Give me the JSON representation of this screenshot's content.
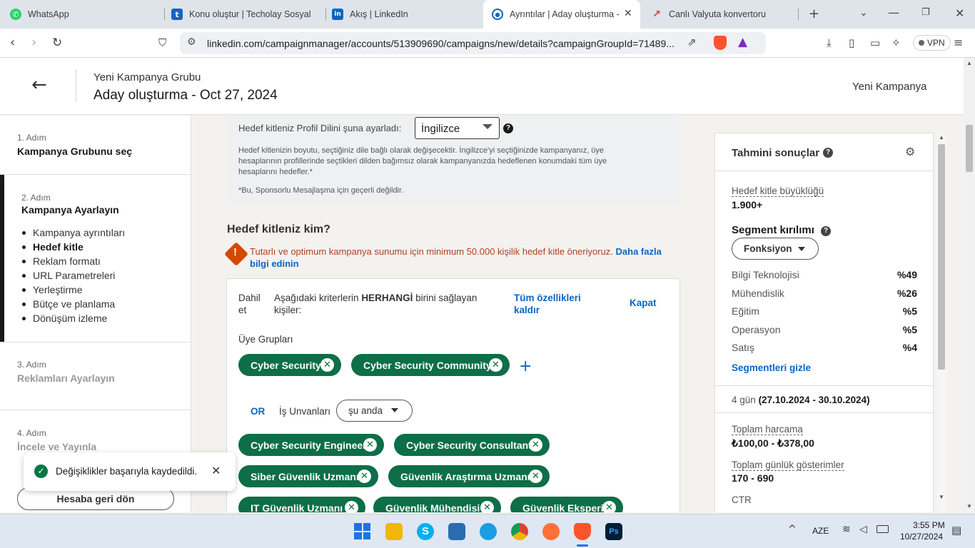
{
  "browser": {
    "tabs": [
      {
        "title": "WhatsApp",
        "fav_color": "#25d366",
        "fav_glyph": "✆"
      },
      {
        "title": "Konu oluştur | Techolay Sosyal",
        "fav_color": "#1565c0",
        "fav_glyph": "t"
      },
      {
        "title": "Akış | LinkedIn",
        "fav_color": "#0a66c2",
        "fav_glyph": "in"
      },
      {
        "title": "Ayrıntılar | Aday oluşturma -",
        "fav_color": "#0a66c2",
        "fav_glyph": "◎"
      },
      {
        "title": "Canlı Valyuta konvertoru",
        "fav_color": "#e53935",
        "fav_glyph": "↗"
      }
    ],
    "url": "linkedin.com/campaignmanager/accounts/513909690/campaigns/new/details?campaignGroupId=71489...",
    "vpn_label": "VPN"
  },
  "header": {
    "group_label": "Yeni Kampanya Grubu",
    "title": "Aday oluşturma - Oct 27, 2024",
    "right_label": "Yeni Kampanya"
  },
  "sidebar": {
    "step1_label": "1. Adım",
    "step1_title": "Kampanya Grubunu seç",
    "step2_label": "2. Adım",
    "step2_title": "Kampanya Ayarlayın",
    "sub_items": [
      "Kampanya ayrıntıları",
      "Hedef kitle",
      "Reklam formatı",
      "URL Parametreleri",
      "Yerleştirme",
      "Bütçe ve planlama",
      "Dönüşüm izleme"
    ],
    "step3_label": "3. Adım",
    "step3_title": "Reklamları Ayarlayın",
    "step4_label": "4. Adım",
    "step4_title": "İncele ve Yayınla",
    "back_button": "Hesaba geri dön"
  },
  "main": {
    "language_label": "Hedef kitleniz Profil Dilini şuna ayarladı:",
    "language_value": "İngilizce",
    "language_note": "Hedef kitlenizin boyutu, seçtiğiniz dile bağlı olarak değişecektir. İngilizce'yi seçtiğinizde kampanyanız, üye hesaplarının profillerinde seçtikleri dilden bağımsız olarak kampanyanızda hedeflenen konumdaki tüm üye hesaplarını hedefler.*",
    "sponsor_note": "*Bu, Sponsorlu Mesajlaşma için geçerli değildir.",
    "audience_heading": "Hedef kitleniz kim?",
    "warning_text": "Tutarlı ve optimum kampanya sunumu için minimum 50.000 kişilik hedef kitle öneriyoruz.",
    "warning_link": "Daha fazla bilgi edinin",
    "include_label": "Dahil et",
    "criteria_pre": "Aşağıdaki kriterlerin",
    "criteria_bold": "HERHANGİ",
    "criteria_post": "birini sağlayan kişiler:",
    "remove_all": "Tüm özellikleri kaldır",
    "close": "Kapat",
    "member_groups_label": "Üye Grupları",
    "member_groups": [
      "Cyber Security",
      "Cyber Security Community"
    ],
    "or_label": "OR",
    "job_titles_label": "İş Unvanları",
    "job_titles_dropdown": "şu anda",
    "job_titles": [
      "Cyber Security Engineer",
      "Cyber Security Consultant",
      "Siber Güvenlik Uzmanı",
      "Güvenlik Araştırma Uzmanı",
      "IT Güvenlik Uzmanı",
      "Güvenlik Mühendisi",
      "Güvenlik Eksperi"
    ]
  },
  "results": {
    "title": "Tahmini sonuçlar",
    "audience_size_label": "Hedef kitle büyüklüğü",
    "audience_size": "1.900+",
    "segment_title": "Segment kırılımı",
    "segment_dropdown": "Fonksiyon",
    "segments": [
      {
        "name": "Bilgi Teknolojisi",
        "pct": "%49"
      },
      {
        "name": "Mühendislik",
        "pct": "%26"
      },
      {
        "name": "Eğitim",
        "pct": "%5"
      },
      {
        "name": "Operasyon",
        "pct": "%5"
      },
      {
        "name": "Satış",
        "pct": "%4"
      }
    ],
    "hide_segments": "Segmentleri gizle",
    "duration_pre": "4 gün",
    "duration_range": "(27.10.2024 - 30.10.2024)",
    "total_spend_label": "Toplam harcama",
    "total_spend": "₺100,00 - ₺378,00",
    "daily_impr_label": "Toplam günlük gösterimler",
    "daily_impr": "170 - 690",
    "ctr_label": "CTR"
  },
  "toast": {
    "message": "Değişiklikler başarıyla kaydedildi."
  },
  "taskbar": {
    "lang": "AZE",
    "time": "3:55 PM",
    "date": "10/27/2024",
    "apps": [
      {
        "name": "file-explorer-icon",
        "color": "#f2b705"
      },
      {
        "name": "skype-icon",
        "color": "#00aff0"
      },
      {
        "name": "store-icon",
        "color": "#2b6cb0"
      },
      {
        "name": "edge-icon",
        "color": "#1b9de2"
      },
      {
        "name": "chrome-icon",
        "color": "#db4437"
      },
      {
        "name": "firefox-icon",
        "color": "#ff7139"
      },
      {
        "name": "brave-icon",
        "color": "#fb542b"
      },
      {
        "name": "photoshop-icon",
        "color": "#001e36"
      }
    ]
  }
}
